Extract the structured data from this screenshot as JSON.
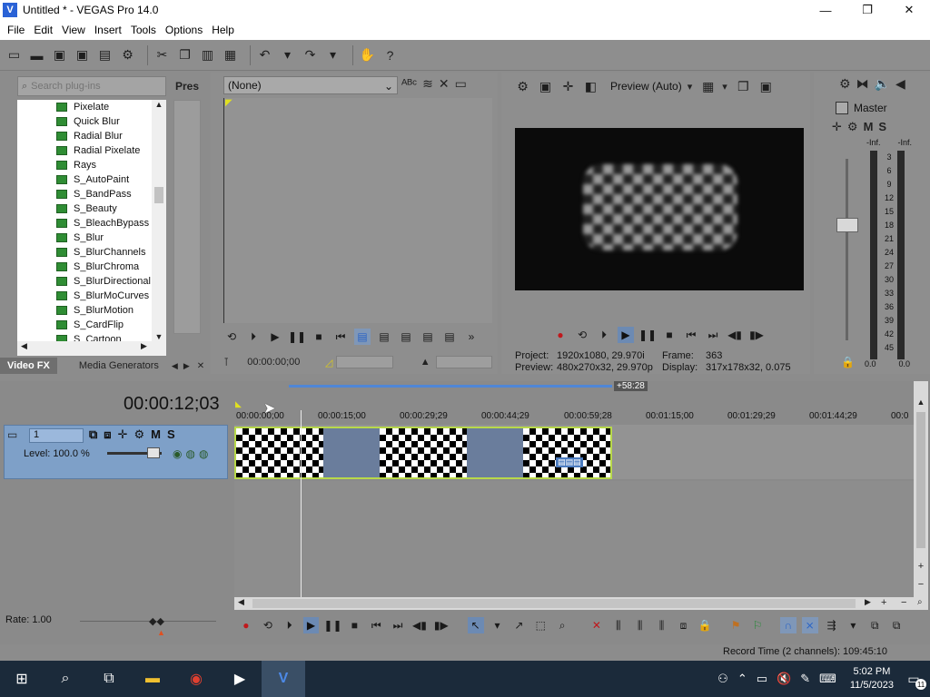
{
  "window": {
    "title": "Untitled * - VEGAS Pro 14.0",
    "logo_letter": "V",
    "minimize_label": "—",
    "maximize_label": "❐",
    "close_label": "✕"
  },
  "menu": {
    "items": [
      "File",
      "Edit",
      "View",
      "Insert",
      "Tools",
      "Options",
      "Help"
    ]
  },
  "plugin_chooser": {
    "search_placeholder": "Search plug-ins",
    "presets_label": "Pres",
    "items": [
      "Pixelate",
      "Quick Blur",
      "Radial Blur",
      "Radial Pixelate",
      "Rays",
      "S_AutoPaint",
      "S_BandPass",
      "S_Beauty",
      "S_BleachBypass",
      "S_Blur",
      "S_BlurChannels",
      "S_BlurChroma",
      "S_BlurDirectional",
      "S_BlurMoCurves",
      "S_BlurMotion",
      "S_CardFlip",
      "S_Cartoon"
    ],
    "tabs": [
      "Video FX",
      "Media Generators"
    ]
  },
  "trimmer": {
    "selected": "(None)",
    "time": "00:00:00;00"
  },
  "preview": {
    "mode": "Preview (Auto)",
    "project_label": "Project:",
    "project_value": "1920x1080, 29.970i",
    "frame_label": "Frame:",
    "frame_value": "363",
    "preview_label": "Preview:",
    "preview_value": "480x270x32, 29.970p",
    "display_label": "Display:",
    "display_value": "317x178x32, 0.075"
  },
  "master": {
    "title": "Master",
    "mute_label": "M",
    "solo_label": "S",
    "inf_left": "-Inf.",
    "inf_right": "-Inf.",
    "scale": [
      "3",
      "6",
      "9",
      "12",
      "15",
      "18",
      "21",
      "24",
      "27",
      "30",
      "33",
      "36",
      "39",
      "42",
      "45",
      "48",
      "51",
      "54",
      "57"
    ],
    "bottom_left": "0.0",
    "bottom_right": "0.0"
  },
  "timeline": {
    "timecode": "00:00:12;03",
    "region_end": "+58:28",
    "ruler": [
      "00:00:00;00",
      "00:00:15;00",
      "00:00:29;29",
      "00:00:44;29",
      "00:00:59;28",
      "00:01:15;00",
      "00:01:29;29",
      "00:01:44;29",
      "00:0"
    ],
    "track_number": "1",
    "track_mute": "M",
    "track_solo": "S",
    "level_text": "Level: 100.0 %"
  },
  "transport": {
    "rate_label": "Rate: 1.00",
    "record_time": "Record Time (2 channels): 109:45:10"
  },
  "taskbar": {
    "time": "5:02 PM",
    "date": "11/5/2023",
    "notifications": "11"
  }
}
